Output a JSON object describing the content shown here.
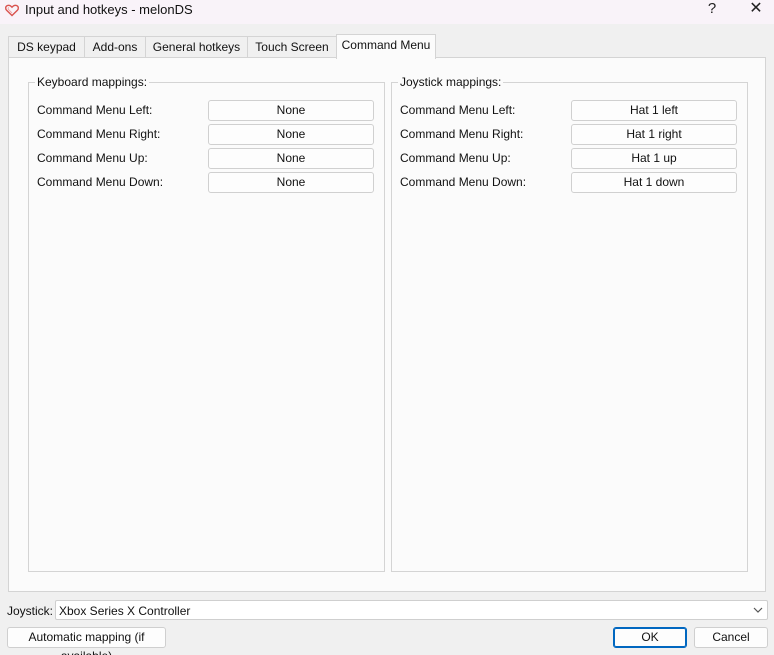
{
  "window": {
    "title": "Input and hotkeys - melonDS",
    "app_icon": "heart-icon",
    "help_label": "?",
    "close_label": "✕"
  },
  "tabs": [
    {
      "label": "DS keypad",
      "active": false
    },
    {
      "label": "Add-ons",
      "active": false
    },
    {
      "label": "General hotkeys",
      "active": false
    },
    {
      "label": "Touch Screen",
      "active": false
    },
    {
      "label": "Command Menu",
      "active": true
    }
  ],
  "keyboard": {
    "title": "Keyboard mappings:",
    "rows": [
      {
        "label": "Command Menu Left:",
        "value": "None"
      },
      {
        "label": "Command Menu Right:",
        "value": "None"
      },
      {
        "label": "Command Menu Up:",
        "value": "None"
      },
      {
        "label": "Command Menu Down:",
        "value": "None"
      }
    ]
  },
  "joystick_mappings": {
    "title": "Joystick mappings:",
    "rows": [
      {
        "label": "Command Menu Left:",
        "value": "Hat 1 left"
      },
      {
        "label": "Command Menu Right:",
        "value": "Hat 1 right"
      },
      {
        "label": "Command Menu Up:",
        "value": "Hat 1 up"
      },
      {
        "label": "Command Menu Down:",
        "value": "Hat 1 down"
      }
    ]
  },
  "joystick": {
    "label": "Joystick:",
    "selected": "Xbox Series X Controller",
    "chevron_icon": "chevron-down-icon"
  },
  "footer": {
    "auto_mapping_label": "Automatic mapping (if available)",
    "ok_label": "OK",
    "cancel_label": "Cancel"
  },
  "colors": {
    "accent": "#0067c0",
    "icon_heart": "#d9534f"
  }
}
